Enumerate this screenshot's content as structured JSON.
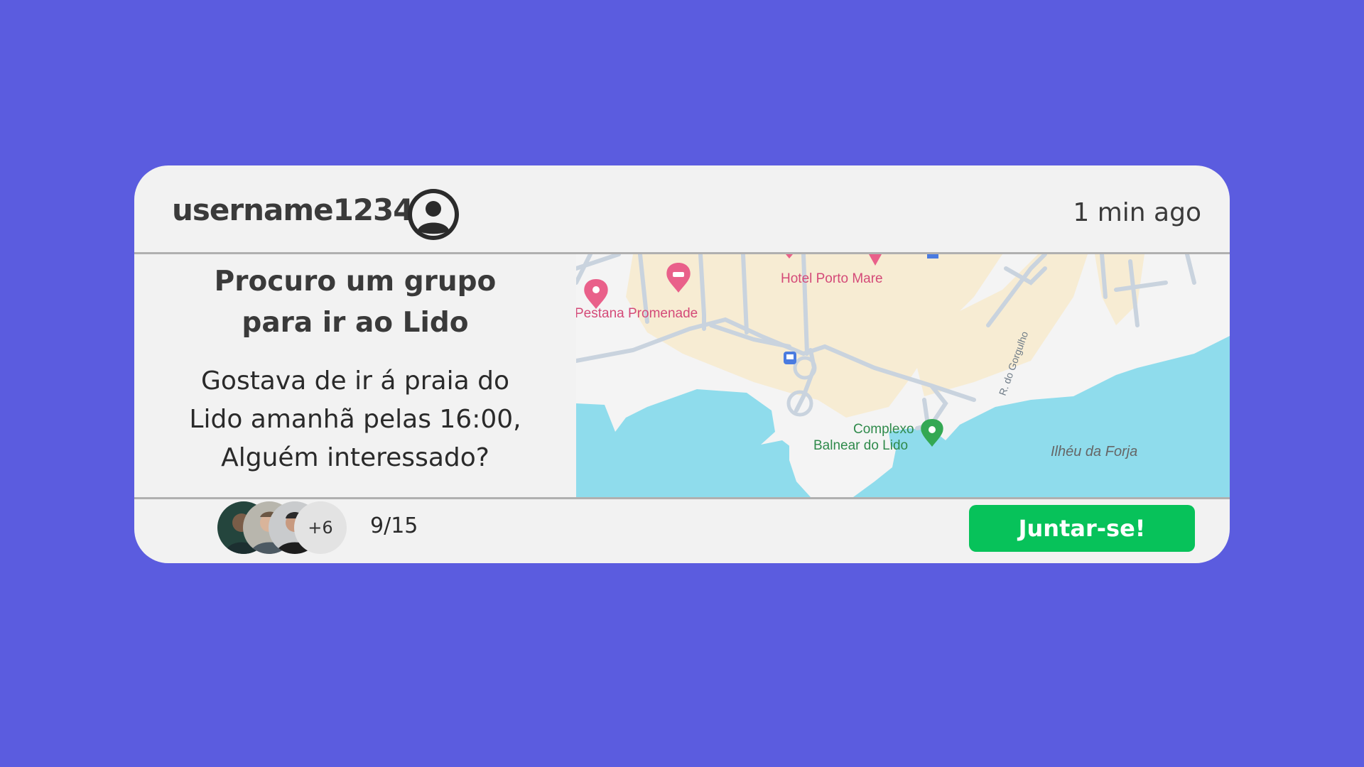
{
  "post": {
    "username": "username1234",
    "timestamp": "1 min ago",
    "title_line1": "Procuro um grupo",
    "title_line2": "para ir ao Lido",
    "body_line1": "Gostava de ir á praia do",
    "body_line2": "Lido amanhã pelas 16:00,",
    "body_line3": "Alguém interessado?"
  },
  "map": {
    "labels": {
      "hotel": "Hotel Porto Mare",
      "pestana": "Pestana Promenade",
      "complexo_line1": "Complexo",
      "complexo_line2": "Balnear do Lido",
      "ilheu": "Ilhéu da Forja",
      "road": "R. do Gorgulho"
    },
    "colors": {
      "water": "#8fdcec",
      "land": "#f4f4f4",
      "built": "#f7ecd3",
      "road": "#c9d3de",
      "pin_pink": "#e9608a",
      "pin_green": "#34a853",
      "bus": "#4a7be0"
    }
  },
  "footer": {
    "more_participants": "+6",
    "count": "9/15",
    "join_label": "Juntar-se!"
  },
  "colors": {
    "background": "#5b5cdf",
    "card": "#f2f2f2",
    "accent_green": "#07c25a"
  }
}
